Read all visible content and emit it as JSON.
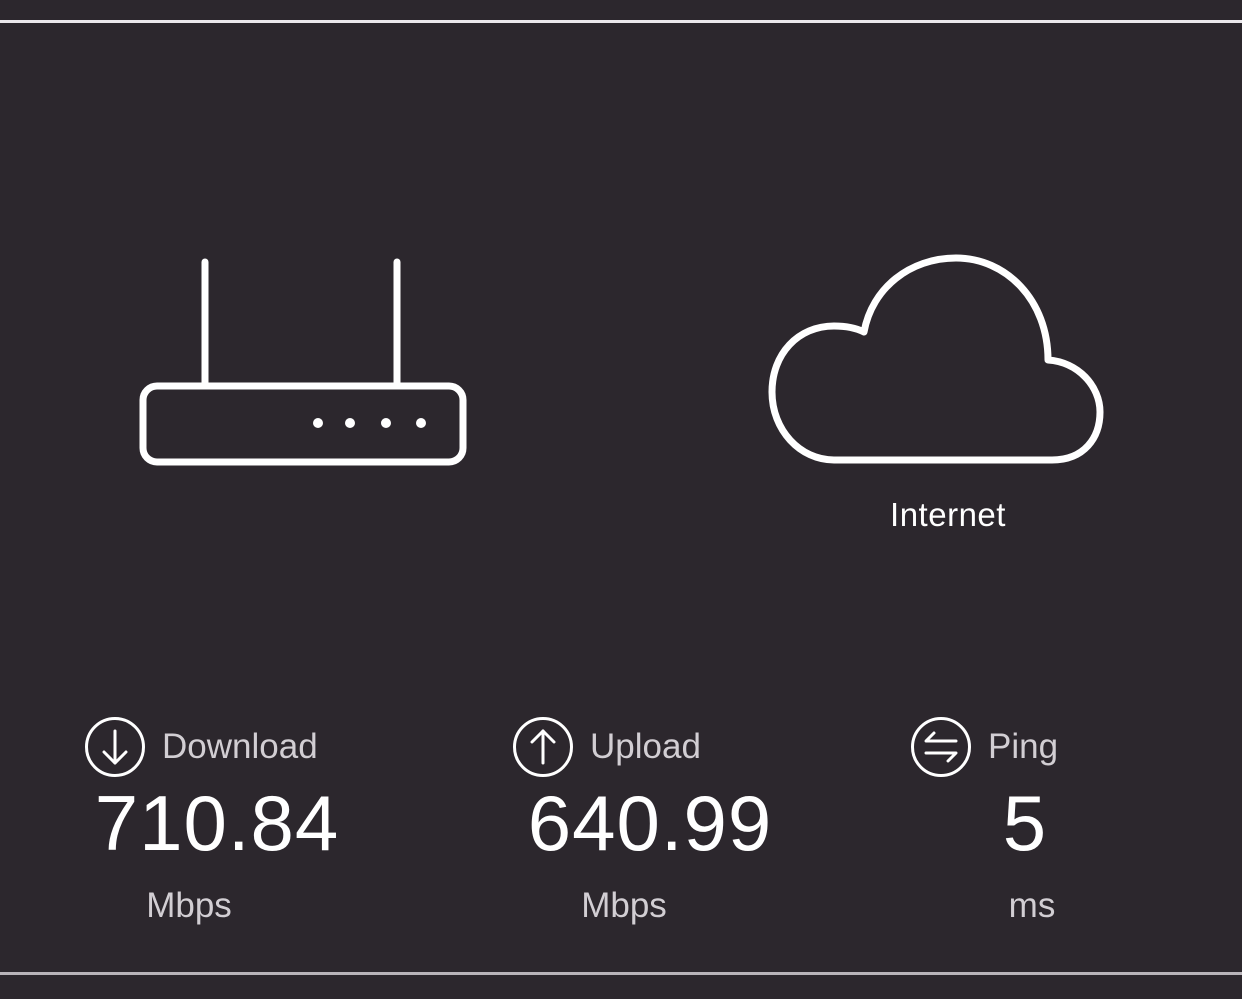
{
  "destination": {
    "label": "Internet",
    "icon": "cloud-icon"
  },
  "source": {
    "icon": "router-icon"
  },
  "metrics": {
    "download": {
      "label": "Download",
      "value": "710.84",
      "unit": "Mbps",
      "icon": "download-arrow-icon"
    },
    "upload": {
      "label": "Upload",
      "value": "640.99",
      "unit": "Mbps",
      "icon": "upload-arrow-icon"
    },
    "ping": {
      "label": "Ping",
      "value": "5",
      "unit": "ms",
      "icon": "ping-arrows-icon"
    }
  },
  "colors": {
    "background": "#2c272d",
    "foreground": "#ffffff",
    "secondary_text": "#d2ced3"
  }
}
